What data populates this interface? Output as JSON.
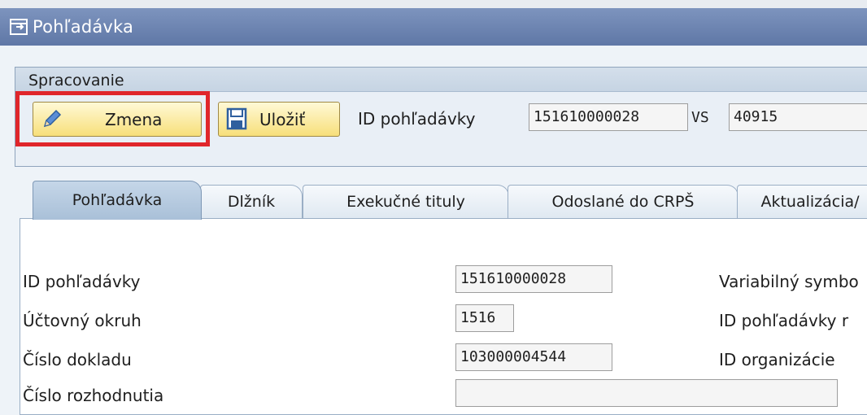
{
  "window": {
    "title": "Pohľadávka"
  },
  "group": {
    "title": "Spracovanie"
  },
  "toolbar": {
    "change_label": "Zmena",
    "save_label": "Uložiť",
    "id_label": "ID pohľadávky",
    "id_value": "151610000028",
    "vs_label": "VS",
    "vs_value": "40915"
  },
  "tabs": [
    {
      "label": "Pohľadávka",
      "active": true
    },
    {
      "label": "Dlžník",
      "active": false
    },
    {
      "label": "Exekučné tituly",
      "active": false
    },
    {
      "label": "Odoslané do CRPŠ",
      "active": false
    },
    {
      "label": "Aktualizácia/",
      "active": false
    }
  ],
  "form": {
    "left": [
      {
        "label": "ID pohľadávky",
        "value": "151610000028"
      },
      {
        "label": "Účtovný okruh",
        "value": "1516"
      },
      {
        "label": "Číslo dokladu",
        "value": "103000004544"
      },
      {
        "label": "Číslo rozhodnutia",
        "value": ""
      }
    ],
    "right": [
      {
        "label": "Variabilný symbo"
      },
      {
        "label": "ID pohľadávky r"
      },
      {
        "label": "ID organizácie"
      }
    ]
  },
  "icons": {
    "title": "window-icon",
    "change": "pencil-icon",
    "save": "floppy-disk-icon"
  },
  "colors": {
    "title_bar": "#6b82b0",
    "button_fill": "#f7df7a",
    "highlight_border": "#e0262b",
    "active_tab": "#b3c8de"
  }
}
